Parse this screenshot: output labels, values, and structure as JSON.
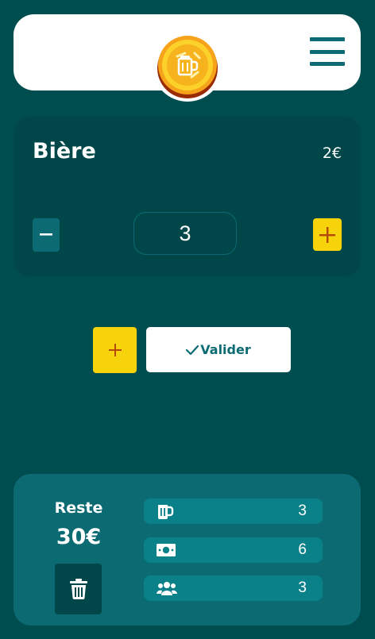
{
  "header": {
    "menu_icon": "hamburger-icon",
    "logo_icon": "beer-coin-icon"
  },
  "item": {
    "name": "Bière",
    "price": "2€",
    "quantity": "3"
  },
  "actions": {
    "validate_label": "Valider"
  },
  "summary": {
    "reste_label": "Reste",
    "reste_value": "30€",
    "stats": [
      {
        "icon": "beer-mug-icon",
        "value": "3"
      },
      {
        "icon": "money-bill-icon",
        "value": "6"
      },
      {
        "icon": "users-icon",
        "value": "3"
      }
    ]
  },
  "colors": {
    "background": "#004d4f",
    "card": "#01474a",
    "accent": "#0c6b72",
    "yellow": "#f6d30a",
    "stat": "#0a8088"
  }
}
